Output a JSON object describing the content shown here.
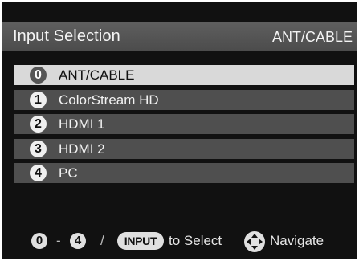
{
  "header": {
    "title": "Input Selection",
    "current_input": "ANT/CABLE"
  },
  "inputs": [
    {
      "number": "0",
      "label": "ANT/CABLE",
      "selected": true
    },
    {
      "number": "1",
      "label": "ColorStream HD",
      "selected": false
    },
    {
      "number": "2",
      "label": "HDMI 1",
      "selected": false
    },
    {
      "number": "3",
      "label": "HDMI 2",
      "selected": false
    },
    {
      "number": "4",
      "label": "PC",
      "selected": false
    }
  ],
  "footer": {
    "range_start": "0",
    "range_dash": "-",
    "range_end": "4",
    "separator": "/",
    "input_key": "INPUT",
    "select_text": "to Select",
    "navigate_icon": "dpad-icon",
    "navigate_text": "Navigate"
  },
  "colors": {
    "panel": "#111111",
    "header": "#555555",
    "item": "#4f4f4f",
    "item_selected": "#d9d9d9"
  }
}
